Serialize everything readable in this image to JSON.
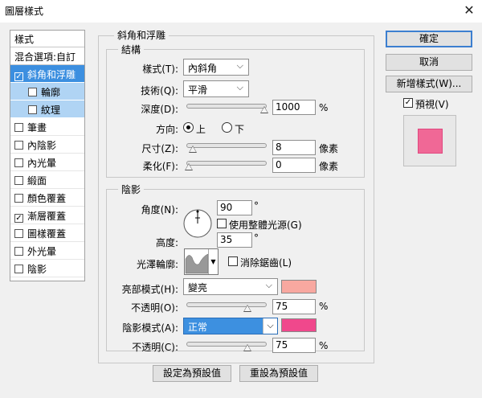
{
  "window": {
    "title": "圖層樣式",
    "close": "✕"
  },
  "style_list": {
    "header": "樣式",
    "blend_options": "混合選項:自訂",
    "items": [
      {
        "label": "斜角和浮雕",
        "checked": true,
        "state": "selected"
      },
      {
        "label": "輪廓",
        "checked": false,
        "state": "sub"
      },
      {
        "label": "紋理",
        "checked": false,
        "state": "sub"
      },
      {
        "label": "筆畫",
        "checked": false,
        "state": "normal"
      },
      {
        "label": "內陰影",
        "checked": false,
        "state": "normal"
      },
      {
        "label": "內光暈",
        "checked": false,
        "state": "normal"
      },
      {
        "label": "緞面",
        "checked": false,
        "state": "normal"
      },
      {
        "label": "顏色覆蓋",
        "checked": false,
        "state": "normal"
      },
      {
        "label": "漸層覆蓋",
        "checked": true,
        "state": "normal"
      },
      {
        "label": "圖樣覆蓋",
        "checked": false,
        "state": "normal"
      },
      {
        "label": "外光暈",
        "checked": false,
        "state": "normal"
      },
      {
        "label": "陰影",
        "checked": false,
        "state": "normal"
      }
    ]
  },
  "bevel": {
    "section_title": "斜角和浮雕",
    "structure": {
      "title": "結構",
      "style_label": "樣式(T):",
      "style_value": "內斜角",
      "technique_label": "技術(Q):",
      "technique_value": "平滑",
      "depth_label": "深度(D):",
      "depth_value": "1000",
      "depth_unit": "%",
      "direction_label": "方向:",
      "direction_up": "上",
      "direction_down": "下",
      "direction_selected": "上",
      "size_label": "尺寸(Z):",
      "size_value": "8",
      "size_unit": "像素",
      "soften_label": "柔化(F):",
      "soften_value": "0",
      "soften_unit": "像素"
    },
    "shading": {
      "title": "陰影",
      "angle_label": "角度(N):",
      "angle_value": "90",
      "angle_unit": "°",
      "global_light_label": "使用整體光源(G)",
      "global_light_checked": false,
      "altitude_label": "高度:",
      "altitude_value": "35",
      "altitude_unit": "°",
      "gloss_contour_label": "光澤輪廓:",
      "anti_alias_label": "消除鋸齒(L)",
      "anti_alias_checked": false,
      "highlight_mode_label": "亮部模式(H):",
      "highlight_mode_value": "變亮",
      "highlight_color": "#f8a8a0",
      "highlight_opacity_label": "不透明(O):",
      "highlight_opacity_value": "75",
      "highlight_opacity_unit": "%",
      "shadow_mode_label": "陰影模式(A):",
      "shadow_mode_value": "正常",
      "shadow_color": "#f0488c",
      "shadow_opacity_label": "不透明(C):",
      "shadow_opacity_value": "75",
      "shadow_opacity_unit": "%"
    },
    "make_default": "設定為預設值",
    "reset_default": "重設為預設值"
  },
  "buttons": {
    "ok": "確定",
    "cancel": "取消",
    "new_style": "新增樣式(W)...",
    "preview_label": "預視(V)",
    "preview_checked": true
  },
  "preview": {
    "swatch_color": "#f06896",
    "bg_color": "#e8e8e8"
  },
  "icons": {
    "check": "✓",
    "dropdown": "⌵"
  }
}
